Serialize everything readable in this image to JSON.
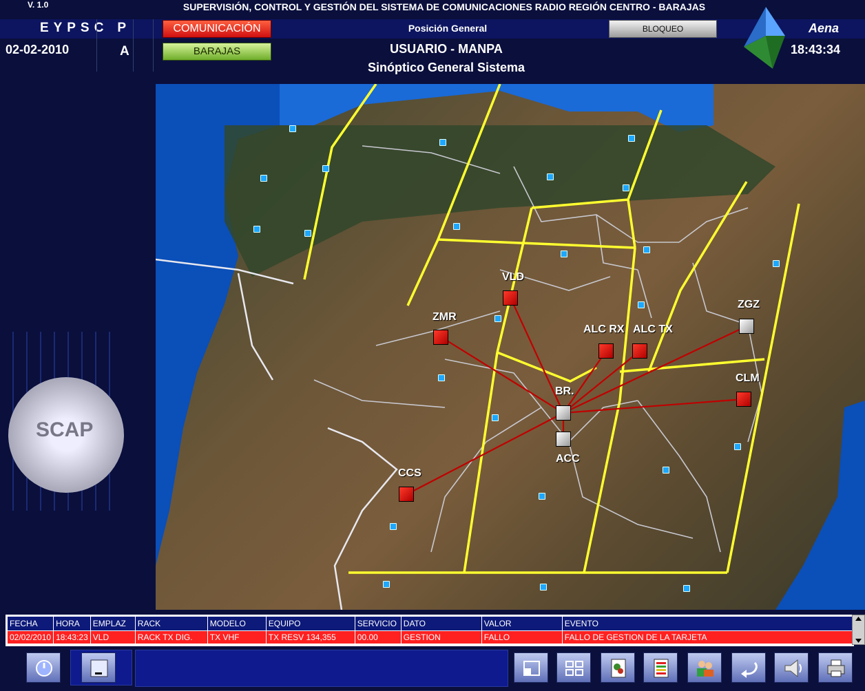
{
  "header": {
    "version": "V. 1.0",
    "title": "SUPERVISIÓN, CONTROL Y GESTIÓN DEL SISTEMA DE COMUNICACIONES RADIO REGIÓN CENTRO - BARAJAS",
    "letters": "E Y P S C   P",
    "letter_a": "A",
    "date": "02-02-2010",
    "time": "18:43:34",
    "btn_comunicacion": "COMUNICACIÓN",
    "btn_barajas": "BARAJAS",
    "posicion": "Posición General",
    "btn_bloqueo": "BLOQUEO",
    "brand": "Aena",
    "user": "USUARIO - MANPA",
    "screen": "Sinóptico General Sistema"
  },
  "logo": {
    "text": "SCAP"
  },
  "map": {
    "nodes": [
      {
        "id": "vld",
        "label": "VLD",
        "status": "red"
      },
      {
        "id": "zmr",
        "label": "ZMR",
        "status": "red"
      },
      {
        "id": "alc-rx",
        "label": "ALC RX",
        "status": "red"
      },
      {
        "id": "alc-tx",
        "label": "ALC TX",
        "status": "red"
      },
      {
        "id": "zgz",
        "label": "ZGZ",
        "status": "grey"
      },
      {
        "id": "clm",
        "label": "CLM",
        "status": "red"
      },
      {
        "id": "br",
        "label": "BR.",
        "status": "grey"
      },
      {
        "id": "acc",
        "label": "ACC",
        "status": "grey"
      },
      {
        "id": "ccs",
        "label": "CCS",
        "status": "red"
      }
    ],
    "colors": {
      "alarm": "#e01010",
      "ok": "#c8c8c8",
      "sector": "#ffff30",
      "link": "#c00000"
    }
  },
  "events": {
    "columns": [
      "FECHA",
      "HORA",
      "EMPLAZ",
      "RACK",
      "MODELO",
      "EQUIPO",
      "SERVICIO",
      "DATO",
      "VALOR",
      "EVENTO"
    ],
    "rows": [
      [
        "02/02/2010",
        "18:43:23",
        "VLD",
        "RACK TX DIG.",
        "TX VHF",
        "TX RESV 134,355",
        "00.00",
        "GESTION",
        "FALLO",
        "FALLO DE GESTION DE LA TARJETA"
      ]
    ]
  },
  "toolbar": {
    "icons": [
      "power-icon",
      "minimize-icon",
      "window-icon",
      "grid-icon",
      "map-report-icon",
      "list-icon",
      "users-icon",
      "return-icon",
      "alarm-horn-icon",
      "printer-icon"
    ]
  }
}
